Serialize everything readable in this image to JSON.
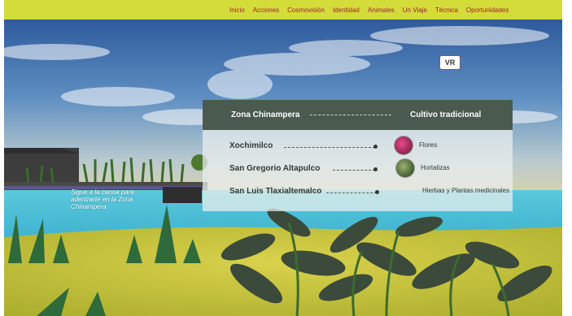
{
  "nav": {
    "items": [
      "Inicio",
      "Acciones",
      "Cosmovisión",
      "Identidad",
      "Animales",
      "Un Viaje",
      "Técnica",
      "Oportunidades"
    ]
  },
  "vr_button": {
    "label": "VR"
  },
  "panel": {
    "zone_title": "Zona Chinampera",
    "column_title": "Cultivo tradicional",
    "rows": [
      {
        "place": "Xochimilco",
        "crop": "Flores",
        "thumb_icon": "flowers-icon"
      },
      {
        "place": "San Gregorio Altapulco",
        "crop": "Hortalizas",
        "thumb_icon": "vegetables-icon"
      },
      {
        "place": "San Luis Tlaxialtemalco",
        "crop": "Hierbas y Plantas medicinales",
        "thumb_icon": ""
      }
    ]
  },
  "caption": "Sigue a la canoa para adentrarte en la Zona Chinampera",
  "colors": {
    "topbar": "#d4dc3a",
    "nav_text": "#a0203a",
    "panel_header": "#4a5a4f",
    "water": "#4fc0d8",
    "grass": "#c9c240"
  }
}
